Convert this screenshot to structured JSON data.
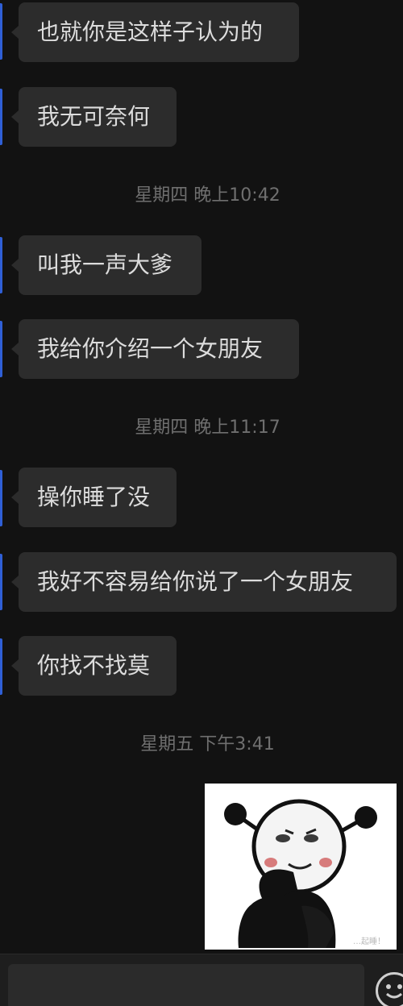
{
  "messages": [
    {
      "text": "也就你是这样子认为的"
    },
    {
      "text": "我无可奈何"
    },
    {
      "text": "叫我一声大爹"
    },
    {
      "text": "我给你介绍一个女朋友"
    },
    {
      "text": "操你睡了没"
    },
    {
      "text": "我好不容易给你说了一个女朋友"
    },
    {
      "text": "你找不找莫"
    }
  ],
  "timestamps": [
    "星期四 晚上10:42",
    "星期四 晚上11:17",
    "星期五 下午3:41"
  ],
  "sticker": {
    "icon": "meme-sticker-icon",
    "watermark_text": "…起睡！"
  },
  "input": {
    "value": "",
    "placeholder": ""
  },
  "colors": {
    "background": "#121212",
    "bubble": "#2c2c2c",
    "bubble_text": "#dcdcdc",
    "timestamp": "#6f6f6f",
    "sender_strip": "#2f5fd6"
  }
}
